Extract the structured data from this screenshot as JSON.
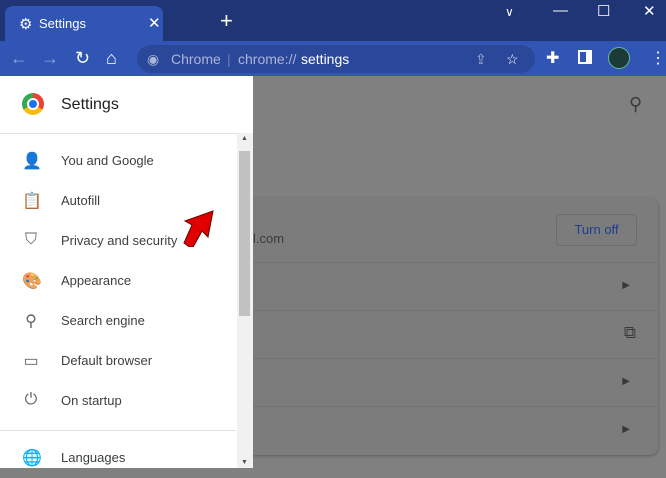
{
  "tab": {
    "title": "Settings"
  },
  "toolbar": {
    "omnibox_site": "Chrome",
    "omnibox_url_prefix": "chrome://",
    "omnibox_url_path": "settings"
  },
  "sidebar": {
    "title": "Settings",
    "items": [
      {
        "label": "You and Google",
        "icon": "person-icon"
      },
      {
        "label": "Autofill",
        "icon": "clipboard-icon"
      },
      {
        "label": "Privacy and security",
        "icon": "shield-icon"
      },
      {
        "label": "Appearance",
        "icon": "palette-icon"
      },
      {
        "label": "Search engine",
        "icon": "search-icon"
      },
      {
        "label": "Default browser",
        "icon": "browser-icon"
      },
      {
        "label": "On startup",
        "icon": "power-icon"
      },
      {
        "label": "Languages",
        "icon": "globe-icon"
      }
    ]
  },
  "main": {
    "email_fragment": "l.com",
    "turn_off_label": "Turn off"
  },
  "colors": {
    "frame": "#1f3576",
    "toolbar": "#3155b4",
    "accent_arrow": "#e00000"
  }
}
